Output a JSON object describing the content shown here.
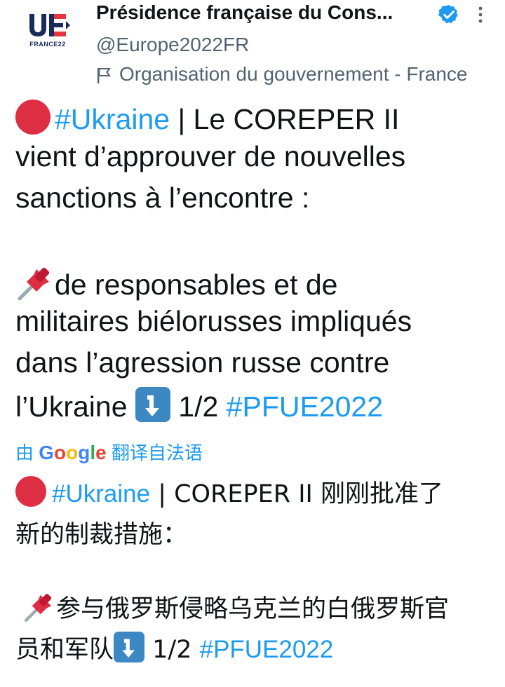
{
  "account": {
    "display_name": "Présidence française du Cons...",
    "handle": "@Europe2022FR",
    "affiliation": "Organisation du gouvernement - France",
    "logo_text": "FRANCE22",
    "verified": true
  },
  "icons": {
    "verified": "verified-badge-icon",
    "more": "more-vertical-icon",
    "affiliation": "flag-icon",
    "red_circle": "red-circle-emoji",
    "pin": "pushpin-emoji",
    "arrow": "arrow-down-right-emoji"
  },
  "tweet": {
    "line1_text": " | Le COREPER II",
    "line1_hashtag": "#Ukraine",
    "line2": "vient d’approuver de nouvelles",
    "line3": "sanctions à l’encontre :",
    "line4": "de responsables et de",
    "line5": "militaires biélorusses impliqués",
    "line6": "dans l’agression russe contre",
    "line7_prefix": "l’Ukraine ",
    "line7_suffix": " 1/2 ",
    "line7_hashtag": "#PFUE2022"
  },
  "translation": {
    "prefix": "由",
    "google": "Google",
    "suffix": "翻译自法语",
    "line1_hashtag": "#Ukraine",
    "line1_text": " | COREPER II 刚刚批准了",
    "line2": "新的制裁措施：",
    "line3": "参与俄罗斯侵略乌克兰的白俄罗斯官",
    "line4_prefix": "员和军队",
    "line4_suffix": " 1/2 ",
    "line4_hashtag": "#PFUE2022"
  },
  "colors": {
    "link": "#1d9bf0",
    "secondary_text": "#536471",
    "primary_text": "#0f1419",
    "red_emoji": "#dd2e44",
    "arrow_emoji": "#3b88c3"
  }
}
